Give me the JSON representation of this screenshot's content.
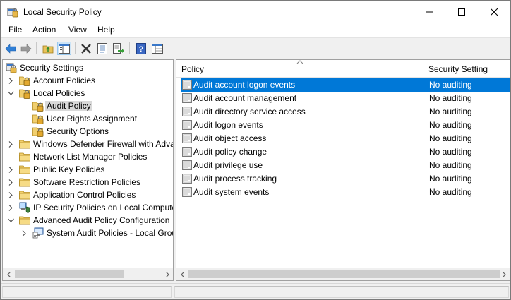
{
  "window": {
    "title": "Local Security Policy",
    "icon": "security-policy-icon"
  },
  "menu": [
    "File",
    "Action",
    "View",
    "Help"
  ],
  "toolbar": {
    "buttons": [
      "back-arrow-icon",
      "forward-arrow-icon",
      "up-folder-icon",
      "show-hide-tree-icon",
      "delete-icon",
      "properties-icon",
      "export-list-icon",
      "help-icon",
      "console-view-icon"
    ]
  },
  "tree": {
    "items": [
      {
        "label": "Security Settings",
        "icon": "security-settings-icon",
        "expander": "none",
        "selected": false
      },
      {
        "label": "Account Policies",
        "icon": "folder-lock-icon",
        "expander": "collapsed",
        "selected": false
      },
      {
        "label": "Local Policies",
        "icon": "folder-lock-icon",
        "expander": "expanded",
        "selected": false
      },
      {
        "label": "Audit Policy",
        "icon": "folder-lock-icon",
        "expander": "none",
        "selected": true
      },
      {
        "label": "User Rights Assignment",
        "icon": "folder-lock-icon",
        "expander": "none",
        "selected": false
      },
      {
        "label": "Security Options",
        "icon": "folder-lock-icon",
        "expander": "none",
        "selected": false
      },
      {
        "label": "Windows Defender Firewall with Adva",
        "icon": "folder-icon",
        "expander": "collapsed",
        "selected": false
      },
      {
        "label": "Network List Manager Policies",
        "icon": "folder-icon",
        "expander": "none",
        "selected": false
      },
      {
        "label": "Public Key Policies",
        "icon": "folder-icon",
        "expander": "collapsed",
        "selected": false
      },
      {
        "label": "Software Restriction Policies",
        "icon": "folder-icon",
        "expander": "collapsed",
        "selected": false
      },
      {
        "label": "Application Control Policies",
        "icon": "folder-icon",
        "expander": "collapsed",
        "selected": false
      },
      {
        "label": "IP Security Policies on Local Compute",
        "icon": "ip-security-icon",
        "expander": "collapsed",
        "selected": false
      },
      {
        "label": "Advanced Audit Policy Configuration",
        "icon": "folder-icon",
        "expander": "expanded",
        "selected": false
      },
      {
        "label": "System Audit Policies - Local Grou",
        "icon": "audit-computer-icon",
        "expander": "collapsed",
        "selected": false
      }
    ]
  },
  "list": {
    "columns": [
      "Policy",
      "Security Setting"
    ],
    "rows": [
      {
        "policy": "Audit account logon events",
        "setting": "No auditing",
        "selected": true
      },
      {
        "policy": "Audit account management",
        "setting": "No auditing",
        "selected": false
      },
      {
        "policy": "Audit directory service access",
        "setting": "No auditing",
        "selected": false
      },
      {
        "policy": "Audit logon events",
        "setting": "No auditing",
        "selected": false
      },
      {
        "policy": "Audit object access",
        "setting": "No auditing",
        "selected": false
      },
      {
        "policy": "Audit policy change",
        "setting": "No auditing",
        "selected": false
      },
      {
        "policy": "Audit privilege use",
        "setting": "No auditing",
        "selected": false
      },
      {
        "policy": "Audit process tracking",
        "setting": "No auditing",
        "selected": false
      },
      {
        "policy": "Audit system events",
        "setting": "No auditing",
        "selected": false
      }
    ]
  },
  "colors": {
    "selection": "#0078d7",
    "tree_selection": "#d9d9d9",
    "toolbar_pressed": "#cce4f7"
  }
}
